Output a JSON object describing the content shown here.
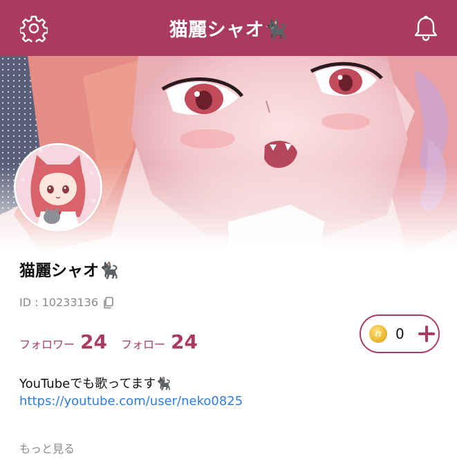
{
  "header": {
    "title": "猫麗シャオ🐈‍⬛",
    "left_icon": "gear-icon",
    "right_icon": "bell-icon"
  },
  "profile": {
    "name": "猫麗シャオ🐈‍⬛",
    "id_text": "ID : 10233136",
    "followers_label": "フォロワー",
    "followers_count": "24",
    "following_label": "フォロー",
    "following_count": "24",
    "coin_count": "0",
    "bio_text": "YouTubeでも歌ってます🐈‍⬛",
    "bio_link": "https://youtube.com/user/neko0825",
    "more_label": "もっと見る"
  },
  "colors": {
    "accent": "#a93c5e",
    "link": "#2f7de1",
    "muted": "#8a8a8a"
  }
}
